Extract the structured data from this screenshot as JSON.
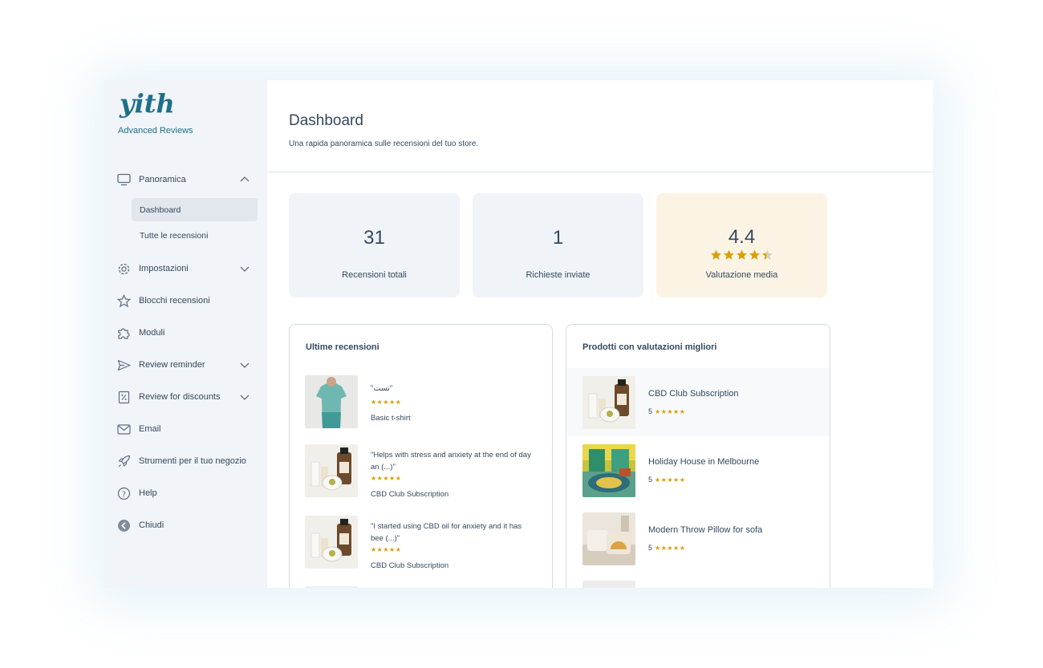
{
  "app": {
    "logo_text": "yith",
    "brand": "Advanced Reviews"
  },
  "sidebar": {
    "items": [
      {
        "label": "Panoramica",
        "icon": "monitor-icon",
        "chevron": "up"
      },
      {
        "label": "Impostazioni",
        "icon": "gear-icon",
        "chevron": "down"
      },
      {
        "label": "Blocchi recensioni",
        "icon": "star-icon",
        "chevron": ""
      },
      {
        "label": "Moduli",
        "icon": "puzzle-icon",
        "chevron": ""
      },
      {
        "label": "Review reminder",
        "icon": "send-icon",
        "chevron": "down"
      },
      {
        "label": "Review for discounts",
        "icon": "discount-icon",
        "chevron": "down"
      },
      {
        "label": "Email",
        "icon": "envelope-icon",
        "chevron": ""
      },
      {
        "label": "Strumenti per il tuo negozio",
        "icon": "rocket-icon",
        "chevron": ""
      },
      {
        "label": "Help",
        "icon": "help-icon",
        "chevron": ""
      },
      {
        "label": "Chiudi",
        "icon": "close-arrow-icon",
        "chevron": ""
      }
    ],
    "subitems": [
      {
        "label": "Dashboard",
        "active": true
      },
      {
        "label": "Tutte le recensioni",
        "active": false
      }
    ]
  },
  "header": {
    "title": "Dashboard",
    "subtitle": "Una rapida panoramica sulle recensioni del tuo store."
  },
  "stats": [
    {
      "value": "31",
      "label": "Recensioni totali"
    },
    {
      "value": "1",
      "label": "Richieste inviate"
    },
    {
      "value": "4.4",
      "label": "Valutazione media",
      "rating": 4.4
    }
  ],
  "latest_reviews": {
    "title": "Ultime recensioni",
    "items": [
      {
        "text": "\"تست\"",
        "stars": "★★★★★",
        "product": "Basic t-shirt",
        "thumb": "tshirt"
      },
      {
        "text": "\"Helps with stress and anxiety at the end of day an (...)\"",
        "stars": "★★★★★",
        "product": "CBD Club Subscription",
        "thumb": "cbd"
      },
      {
        "text": "\"I started using CBD oil for anxiety and it has bee (...)\"",
        "stars": "★★★★★",
        "product": "CBD Club Subscription",
        "thumb": "cbd"
      }
    ]
  },
  "top_products": {
    "title": "Prodotti con valutazioni migliori",
    "items": [
      {
        "name": "CBD Club Subscription",
        "rating": "5",
        "stars": "★★★★★",
        "thumb": "cbd"
      },
      {
        "name": "Holiday House in Melbourne",
        "rating": "5",
        "stars": "★★★★★",
        "thumb": "room"
      },
      {
        "name": "Modern Throw Pillow for sofa",
        "rating": "5",
        "stars": "★★★★★",
        "thumb": "pillow"
      }
    ]
  },
  "colors": {
    "accent": "#1f6f8b",
    "star": "#d99e00",
    "warm_card": "#fbf4e5",
    "stat_card": "#f0f4f8",
    "sidebar_bg": "#f1f4f8"
  }
}
